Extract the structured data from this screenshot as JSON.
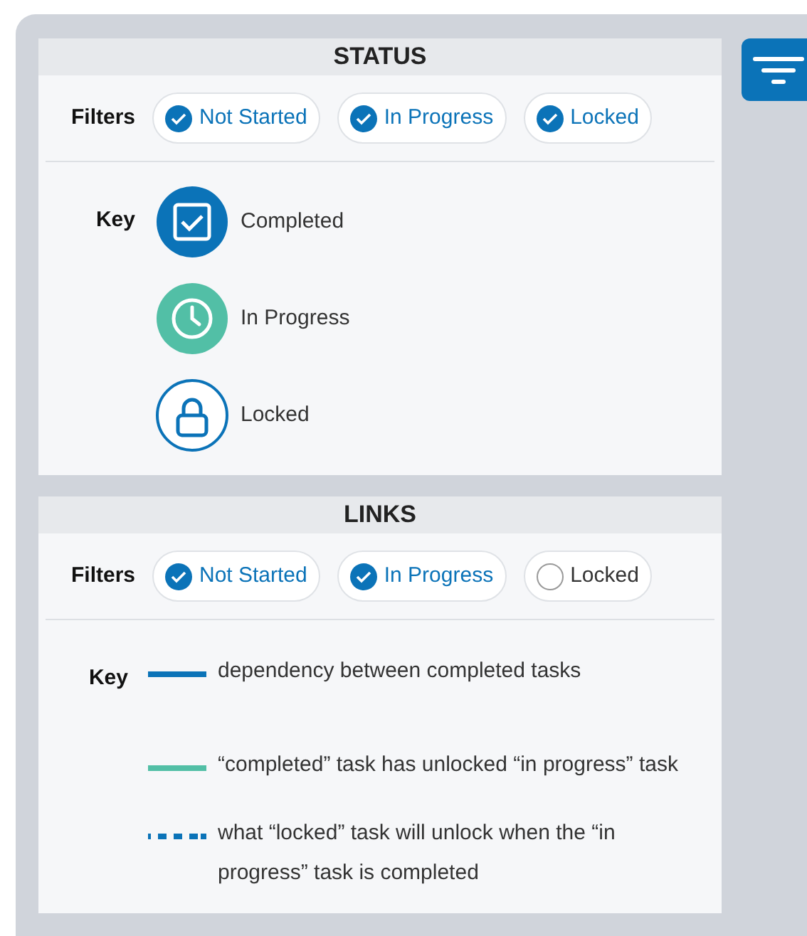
{
  "sections": [
    {
      "title": "STATUS",
      "filters_label": "Filters",
      "filters": [
        {
          "label": "Not Started",
          "checked": true
        },
        {
          "label": "In Progress",
          "checked": true
        },
        {
          "label": "Locked",
          "checked": true
        }
      ],
      "key_label": "Key",
      "key_items": [
        {
          "kind": "completed",
          "label": "Completed"
        },
        {
          "kind": "in_progress",
          "label": "In Progress"
        },
        {
          "kind": "locked",
          "label": "Locked"
        }
      ]
    },
    {
      "title": "LINKS",
      "filters_label": "Filters",
      "filters": [
        {
          "label": "Not Started",
          "checked": true
        },
        {
          "label": "In Progress",
          "checked": true
        },
        {
          "label": "Locked",
          "checked": false
        }
      ],
      "key_label": "Key",
      "key_items": [
        {
          "kind": "solid",
          "color": "#0b73b8",
          "label": "dependency between completed tasks"
        },
        {
          "kind": "solid",
          "color": "#52bfa6",
          "label": "“completed” task has unlocked “in progress” task"
        },
        {
          "kind": "dotted",
          "color": "#0b73b8",
          "label": "what “locked” task will unlock when the “in progress” task is completed"
        }
      ]
    }
  ]
}
